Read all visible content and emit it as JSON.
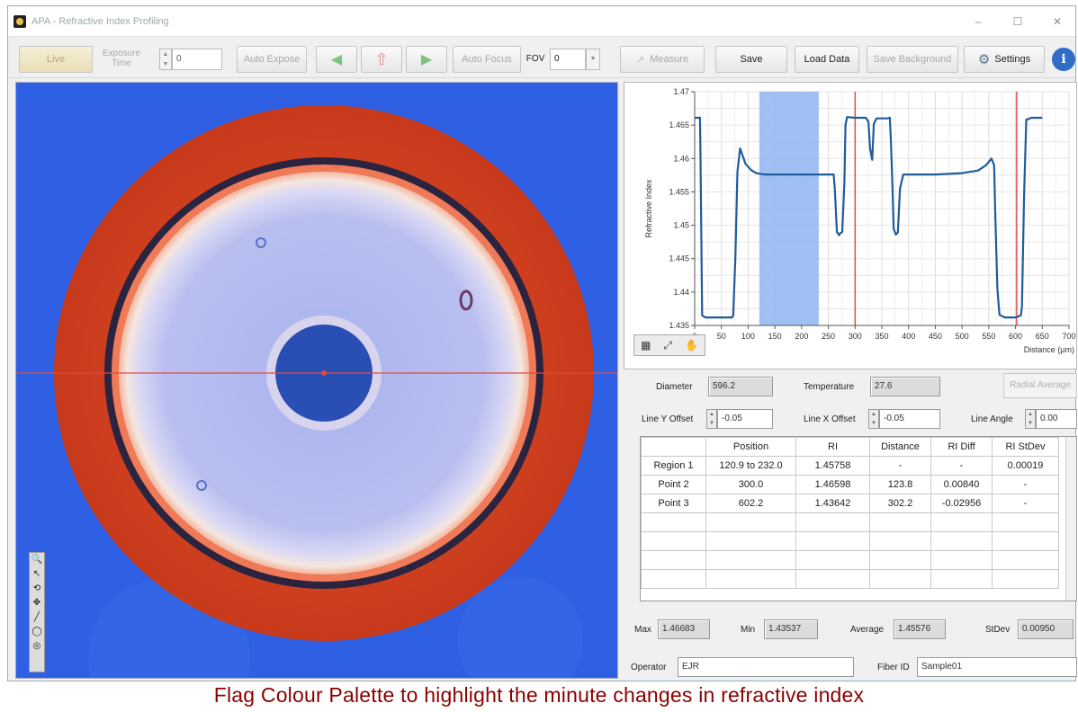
{
  "window": {
    "title": "APA - Refractive Index Profiling",
    "minimize": "–",
    "maximize": "☐",
    "close": "✕"
  },
  "toolbar": {
    "live": "Live",
    "exposure_label": "Exposure Time",
    "exposure_value": "0",
    "auto_expose": "Auto Expose",
    "auto_focus": "Auto Focus",
    "fov_label": "FOV",
    "fov_value": "0",
    "measure": "Measure",
    "save": "Save",
    "load_data": "Load Data",
    "save_background": "Save Background",
    "settings": "Settings",
    "info": "i"
  },
  "chart_data": {
    "type": "line",
    "title": "",
    "xlabel": "Distance (µm)",
    "ylabel": "Refractive Index",
    "xlim": [
      0,
      700
    ],
    "ylim": [
      1.435,
      1.47
    ],
    "x_ticks": [
      0,
      50,
      100,
      150,
      200,
      250,
      300,
      350,
      400,
      450,
      500,
      550,
      600,
      650,
      700
    ],
    "y_ticks": [
      1.435,
      1.44,
      1.445,
      1.45,
      1.455,
      1.46,
      1.465,
      1.47
    ],
    "y_tick_labels": [
      "1.435",
      "1.44",
      "1.445",
      "1.45",
      "1.455",
      "1.46",
      "1.465",
      "1.47"
    ],
    "grid": true,
    "region": [
      120.9,
      232.0
    ],
    "cursors": [
      300.0,
      602.2
    ],
    "colors": {
      "line": "#1f5c99",
      "region": "#8fb4f0",
      "cursor": "#e05050"
    },
    "series": [
      {
        "x": [
          0,
          5,
          10,
          11,
          14,
          20,
          40,
          60,
          70,
          72,
          76,
          80,
          85,
          95,
          105,
          115,
          130,
          150,
          200,
          240,
          260,
          262,
          266,
          270,
          272,
          276,
          280,
          282,
          285,
          300,
          320,
          325,
          328,
          332,
          335,
          340,
          360,
          365,
          367,
          370,
          372,
          376,
          380,
          384,
          390,
          400,
          450,
          500,
          530,
          545,
          555,
          560,
          562,
          566,
          570,
          580,
          600,
          610,
          612,
          616,
          620,
          630,
          640,
          650
        ],
        "values": [
          1.4661,
          1.4661,
          1.4661,
          1.4601,
          1.4365,
          1.4362,
          1.4362,
          1.4362,
          1.4362,
          1.4365,
          1.445,
          1.458,
          1.4615,
          1.4592,
          1.4583,
          1.4578,
          1.4576,
          1.4576,
          1.4576,
          1.4576,
          1.4576,
          1.4555,
          1.449,
          1.4485,
          1.4488,
          1.449,
          1.4565,
          1.465,
          1.4662,
          1.4661,
          1.4661,
          1.4655,
          1.4615,
          1.4598,
          1.4652,
          1.466,
          1.466,
          1.4661,
          1.4625,
          1.4555,
          1.4495,
          1.4486,
          1.4489,
          1.4555,
          1.4576,
          1.4576,
          1.4576,
          1.4578,
          1.4582,
          1.459,
          1.46,
          1.459,
          1.452,
          1.4405,
          1.4366,
          1.4362,
          1.4362,
          1.4365,
          1.4378,
          1.4545,
          1.4658,
          1.4661,
          1.4661,
          1.4661
        ]
      }
    ]
  },
  "palette_icons": [
    "▦",
    "⤢",
    "✋"
  ],
  "measurements": {
    "diameter_label": "Diameter",
    "diameter_value": "596.2",
    "temperature_label": "Temperature",
    "temperature_value": "27.6",
    "radial_average": "Radial Average",
    "line_y_label": "Line Y Offset",
    "line_y_value": "-0.05",
    "line_x_label": "Line X Offset",
    "line_x_value": "-0.05",
    "line_angle_label": "Line Angle",
    "line_angle_value": "0.00"
  },
  "table": {
    "headers": [
      "",
      "Position",
      "RI",
      "Distance",
      "RI Diff",
      "RI StDev"
    ],
    "rows": [
      [
        "Region 1",
        "120.9 to 232.0",
        "1.45758",
        "-",
        "-",
        "0.00019"
      ],
      [
        "Point 2",
        "300.0",
        "1.46598",
        "123.8",
        "0.00840",
        "-"
      ],
      [
        "Point 3",
        "602.2",
        "1.43642",
        "302.2",
        "-0.02956",
        "-"
      ],
      [
        "",
        "",
        "",
        "",
        "",
        ""
      ],
      [
        "",
        "",
        "",
        "",
        "",
        ""
      ],
      [
        "",
        "",
        "",
        "",
        "",
        ""
      ],
      [
        "",
        "",
        "",
        "",
        "",
        ""
      ]
    ]
  },
  "stats": {
    "max_label": "Max",
    "max_value": "1.46683",
    "min_label": "Min",
    "min_value": "1.43537",
    "average_label": "Average",
    "average_value": "1.45576",
    "stdev_label": "StDev",
    "stdev_value": "0.00950"
  },
  "info_fields": {
    "operator_label": "Operator",
    "operator_value": "EJR",
    "fiber_label": "Fiber ID",
    "fiber_value": "Sample01"
  },
  "image_tools": [
    "🔍",
    "↖",
    "⟲",
    "✥",
    "╱",
    "◯",
    "◎"
  ],
  "caption": "Flag Colour Palette to highlight the minute changes in refractive index"
}
